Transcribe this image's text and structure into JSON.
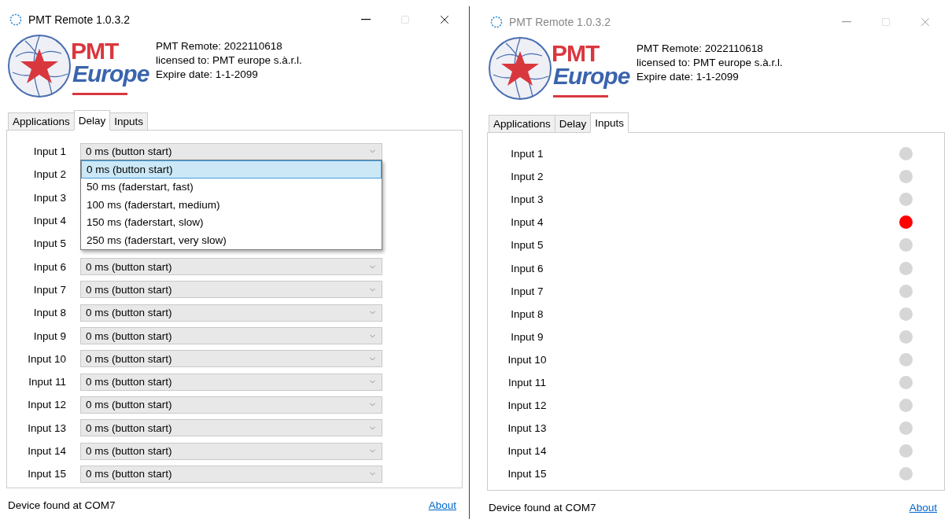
{
  "windows": [
    {
      "title": "PMT Remote 1.0.3.2",
      "active": true,
      "logo": {
        "top": "PMT",
        "bottom": "Europe"
      },
      "info": [
        "PMT Remote: 2022110618",
        "licensed to: PMT europe s.à.r.l.",
        "Expire date: 1-1-2099"
      ],
      "tabs": [
        {
          "label": "Applications",
          "selected": false
        },
        {
          "label": "Delay",
          "selected": true
        },
        {
          "label": "Inputs",
          "selected": false
        }
      ],
      "delay_rows": [
        {
          "label": "Input 1",
          "value": "0 ms (button start)"
        },
        {
          "label": "Input 2"
        },
        {
          "label": "Input 3"
        },
        {
          "label": "Input 4"
        },
        {
          "label": "Input 5"
        },
        {
          "label": "Input 6",
          "value": "0 ms (button start)"
        },
        {
          "label": "Input 7",
          "value": "0 ms (button start)"
        },
        {
          "label": "Input 8",
          "value": "0 ms (button start)"
        },
        {
          "label": "Input 9",
          "value": "0 ms (button start)"
        },
        {
          "label": "Input 10",
          "value": "0 ms (button start)"
        },
        {
          "label": "Input 11",
          "value": "0 ms (button start)"
        },
        {
          "label": "Input 12",
          "value": "0 ms (button start)"
        },
        {
          "label": "Input 13",
          "value": "0 ms (button start)"
        },
        {
          "label": "Input 14",
          "value": "0 ms (button start)"
        },
        {
          "label": "Input 15",
          "value": "0 ms (button start)"
        }
      ],
      "dropdown_options": [
        {
          "label": "0 ms (button start)",
          "selected": true
        },
        {
          "label": "50 ms (faderstart, fast)",
          "selected": false
        },
        {
          "label": "100 ms (faderstart, medium)",
          "selected": false
        },
        {
          "label": "150 ms (faderstart, slow)",
          "selected": false
        },
        {
          "label": "250 ms (faderstart, very slow)",
          "selected": false
        }
      ],
      "status": "Device found at COM7",
      "about_link": "About"
    },
    {
      "title": "PMT Remote 1.0.3.2",
      "active": false,
      "logo": {
        "top": "PMT",
        "bottom": "Europe"
      },
      "info": [
        "PMT Remote: 2022110618",
        "licensed to: PMT europe s.à.r.l.",
        "Expire date: 1-1-2099"
      ],
      "tabs": [
        {
          "label": "Applications",
          "selected": false
        },
        {
          "label": "Delay",
          "selected": false
        },
        {
          "label": "Inputs",
          "selected": true
        }
      ],
      "input_rows": [
        {
          "label": "Input 1",
          "on": false
        },
        {
          "label": "Input 2",
          "on": false
        },
        {
          "label": "Input 3",
          "on": false
        },
        {
          "label": "Input 4",
          "on": true
        },
        {
          "label": "Input 5",
          "on": false
        },
        {
          "label": "Input 6",
          "on": false
        },
        {
          "label": "Input 7",
          "on": false
        },
        {
          "label": "Input 8",
          "on": false
        },
        {
          "label": "Input 9",
          "on": false
        },
        {
          "label": "Input 10",
          "on": false
        },
        {
          "label": "Input 11",
          "on": false
        },
        {
          "label": "Input 12",
          "on": false
        },
        {
          "label": "Input 13",
          "on": false
        },
        {
          "label": "Input 14",
          "on": false
        },
        {
          "label": "Input 15",
          "on": false
        }
      ],
      "status": "Device found at COM7",
      "about_link": "About"
    }
  ]
}
